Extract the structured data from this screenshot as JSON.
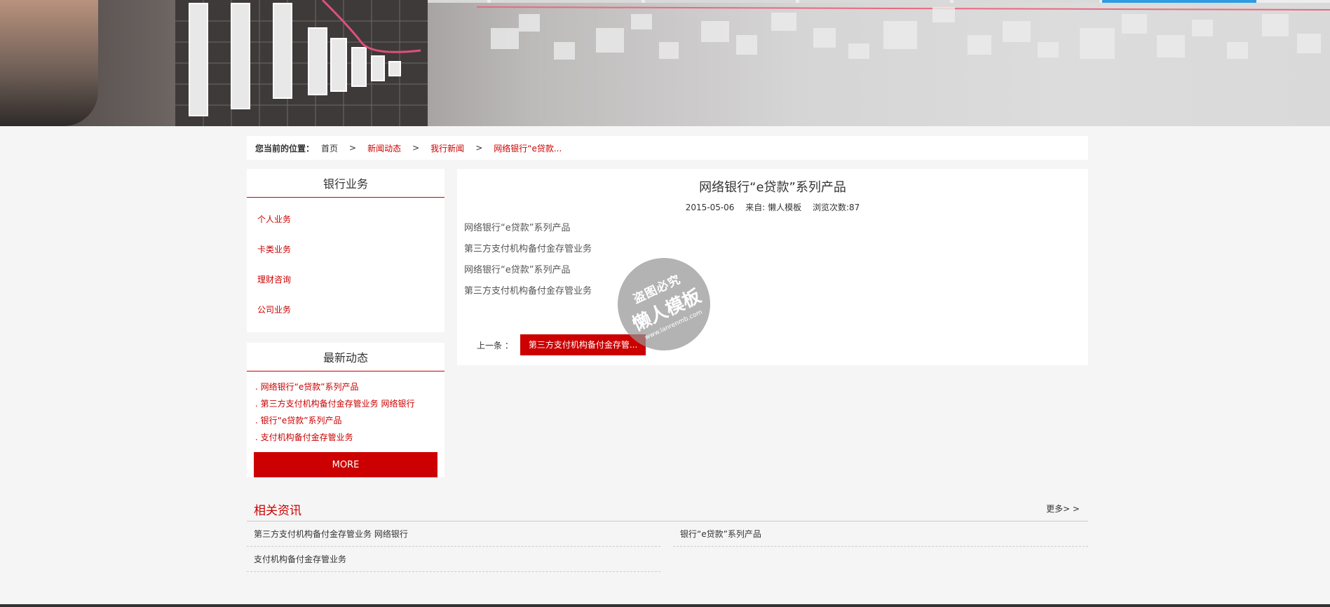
{
  "breadcrumb": {
    "lead": "您当前的位置：",
    "items": [
      "首页",
      "新闻动态",
      "我行新闻",
      "网络银行“e贷款..."
    ],
    "separator": ">"
  },
  "sidebar": {
    "business": {
      "title": "银行业务",
      "items": [
        "个人业务",
        "卡类业务",
        "理财咨询",
        "公司业务"
      ]
    },
    "latest": {
      "title": "最新动态",
      "items": [
        ". 网络银行“e贷款”系列产品",
        ". 第三方支付机构备付金存管业务 网络银行",
        ". 银行“e贷款”系列产品",
        ". 支付机构备付金存管业务"
      ],
      "more_label": "MORE"
    }
  },
  "article": {
    "title": "网络银行“e贷款”系列产品",
    "date": "2015-05-06",
    "source": "来自: 懒人模板",
    "views": "浏览次数:87",
    "paragraphs": [
      "网络银行“e贷款”系列产品",
      "第三方支付机构备付金存管业务",
      "网络银行“e贷款”系列产品",
      "第三方支付机构备付金存管业务"
    ],
    "prev_label": "上一条 ：",
    "prev_link": "第三方支付机构备付金存管..."
  },
  "watermark": {
    "line1": "盗图必究",
    "line2": "懒人模板",
    "line3": "www.lanrenmb.com"
  },
  "related": {
    "title": "相关资讯",
    "more_label": "更多> >",
    "items": [
      "第三方支付机构备付金存管业务 网络银行",
      "银行“e贷款”系列产品",
      "支付机构备付金存管业务"
    ]
  },
  "colors": {
    "accent": "#cc0000",
    "banner_tab_active": "#2e9be3"
  }
}
